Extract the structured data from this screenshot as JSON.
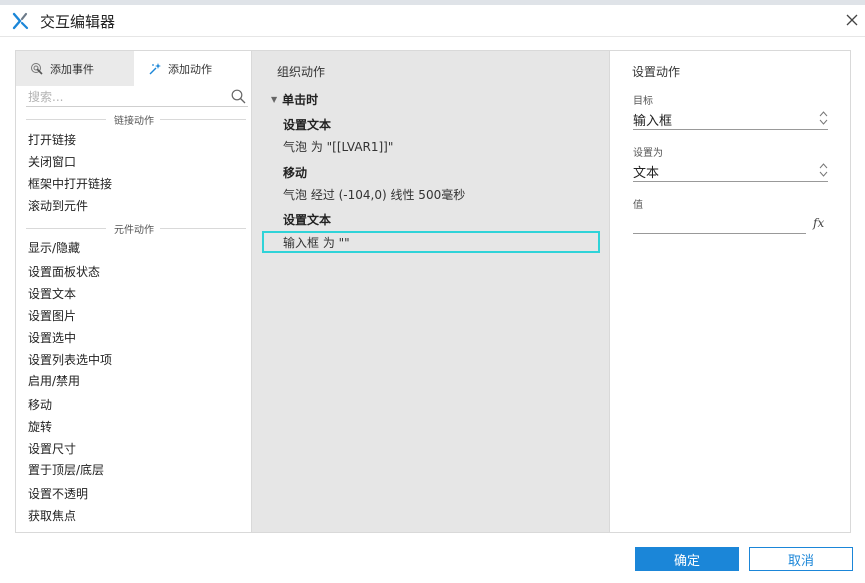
{
  "window": {
    "title": "交互编辑器"
  },
  "left_panel": {
    "tabs": [
      {
        "label": "添加事件",
        "icon": "cursor-click-icon"
      },
      {
        "label": "添加动作",
        "icon": "sparkle-wand-icon"
      }
    ],
    "search": {
      "placeholder": "搜索..."
    },
    "sections": [
      {
        "label": "链接动作",
        "items": [
          "打开链接",
          "关闭窗口",
          "框架中打开链接",
          "滚动到元件"
        ]
      },
      {
        "label": "元件动作",
        "items": [
          "显示/隐藏",
          "设置面板状态",
          "设置文本",
          "设置图片",
          "设置选中",
          "设置列表选中项",
          "启用/禁用",
          "移动",
          "旋转",
          "设置尺寸",
          "置于顶层/底层",
          "设置不透明",
          "获取焦点"
        ]
      }
    ]
  },
  "middle_panel": {
    "title": "组织动作",
    "event": "单击时",
    "actions": [
      {
        "name": "设置文本",
        "desc": "气泡 为 \"[[LVAR1]]\""
      },
      {
        "name": "移动",
        "desc": "气泡 经过 (-104,0) 线性 500毫秒"
      },
      {
        "name": "设置文本",
        "desc": "输入框 为 \"\""
      }
    ]
  },
  "right_panel": {
    "title": "设置动作",
    "target_label": "目标",
    "target_value": "输入框",
    "set_as_label": "设置为",
    "set_as_value": "文本",
    "value_label": "值",
    "value": "",
    "fx_label": "fx"
  },
  "buttons": {
    "ok": "确定",
    "cancel": "取消"
  },
  "colors": {
    "accent": "#1b86d8",
    "selection": "#2fd3d8",
    "middle_bg": "#e6e6e6"
  }
}
